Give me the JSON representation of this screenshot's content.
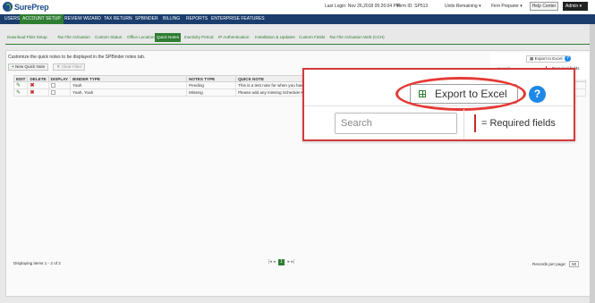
{
  "header": {
    "logo_text": "SurePrep",
    "last_login": "Last Login:  Nov 26,2018 05:26:04 PM",
    "firm_id": "Firm ID:  SP513",
    "units_remaining": "Units Remaining",
    "role": "Firm Preparer",
    "help_center": "Help Center",
    "user_menu": "Admin"
  },
  "nav": {
    "items": [
      "USERS",
      "ACCOUNT SETUP",
      "REVIEW WIZARD",
      "TAX RETURN",
      "SPBINDER",
      "BILLING",
      "REPORTS",
      "ENTERPRISE FEATURES"
    ],
    "active": "ACCOUNT SETUP"
  },
  "subnav": {
    "items": [
      "Download Files Setup",
      "Tax File Activation",
      "Custom Status",
      "Office Location",
      "Quick Notes",
      "Inactivity Period",
      "IP Authentication",
      "Installation & Updates",
      "Custom Fields",
      "Tax File Activation Web (CCH)"
    ],
    "active": "Quick Notes"
  },
  "page": {
    "description": "Customize the quick notes to be displayed in the SPBinder notes tab.",
    "new_quick_note": "New Quick Note",
    "clear_filter": "Clear Filter"
  },
  "table": {
    "columns": [
      "EDIT",
      "DELETE",
      "DISPLAY",
      "BINDER TYPE",
      "NOTES TYPE",
      "QUICK NOTE"
    ],
    "rows": [
      {
        "binder_type": "Yoah",
        "notes_type": "Pending",
        "quick_note": "This is a test note for when you have a pending"
      },
      {
        "binder_type": "Yoah, Yoah",
        "notes_type": "Missing",
        "quick_note": "Please add any missing Schedule K-1 documents"
      }
    ]
  },
  "footer": {
    "displaying": "Displaying items 1 - 2 of 2",
    "pager_first": "|◂",
    "pager_prev": "◂",
    "current_page": "1",
    "pager_next": "▸",
    "pager_last": "▸|",
    "records_label": "Records per page:",
    "records_value": "50"
  },
  "mini_toolbar": {
    "export_label": "Export to Excel",
    "help": "?",
    "search_placeholder": "Search",
    "required": "= Required fields"
  },
  "callout": {
    "export_label": "Export to Excel",
    "help": "?",
    "search_placeholder": "Search",
    "required": "= Required fields"
  },
  "colors": {
    "nav_bg": "#1a3d6d",
    "accent_green": "#2e7d32",
    "callout_red": "#d43a3a",
    "help_blue": "#1e88e5"
  }
}
